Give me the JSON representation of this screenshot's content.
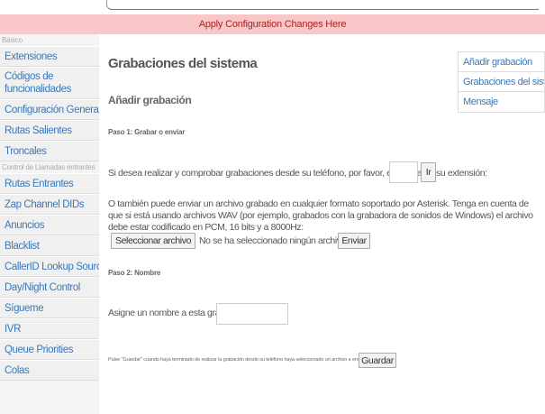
{
  "apply_bar": {
    "label": "Apply Configuration Changes Here"
  },
  "sidebar": {
    "section_basic": "Básico",
    "section_inbound": "Control de Llamadas entrantes",
    "items_basic": [
      {
        "label": "Extensiones"
      },
      {
        "label": "Códigos de funcionalidades"
      },
      {
        "label": "Configuración General"
      },
      {
        "label": "Rutas Salientes"
      },
      {
        "label": "Troncales"
      }
    ],
    "items_inbound": [
      {
        "label": "Rutas Entrantes"
      },
      {
        "label": "Zap Channel DIDs"
      },
      {
        "label": "Anuncios"
      },
      {
        "label": "Blacklist"
      },
      {
        "label": "CallerID Lookup Sources"
      },
      {
        "label": "Day/Night Control"
      },
      {
        "label": "Sígueme"
      },
      {
        "label": "IVR"
      },
      {
        "label": "Queue Priorities"
      },
      {
        "label": "Colas"
      }
    ]
  },
  "main": {
    "title": "Grabaciones del sistema",
    "subtitle": "Añadir grabación",
    "step1": "Paso 1: Grabar o enviar",
    "phone_text": "Si desea realizar y comprobar grabaciones desde su teléfono, por favor, escriba aquí su extensión:",
    "go_button": "Ir",
    "upload_text": "O también puede enviar un archivo grabado en cualquier formato soportado por Asterisk. Tenga en cuenta de que si está usando archivos WAV (por ejemplo, grabados con la grabadora de sonidos de Windows) el archivo debe estar codificado en PCM, 16 bits y a 8000Hz:",
    "select_file_button": "Seleccionar archivo",
    "no_file_text": "No se ha seleccionado ningún archivo",
    "send_button": "Enviar",
    "step2": "Paso 2: Nombre",
    "name_label": "Asigne un nombre a esta grabación:",
    "save_note": "Pulse \"Guardar\" cuando haya terminado de realizar la grabación desde su teléfono haya seleccionado un archivo a enviar",
    "save_button": "Guardar"
  },
  "right_panel": {
    "items": [
      {
        "label": "Añadir grabación"
      },
      {
        "label": "Grabaciones del sistema"
      },
      {
        "label": "Mensaje"
      }
    ]
  }
}
